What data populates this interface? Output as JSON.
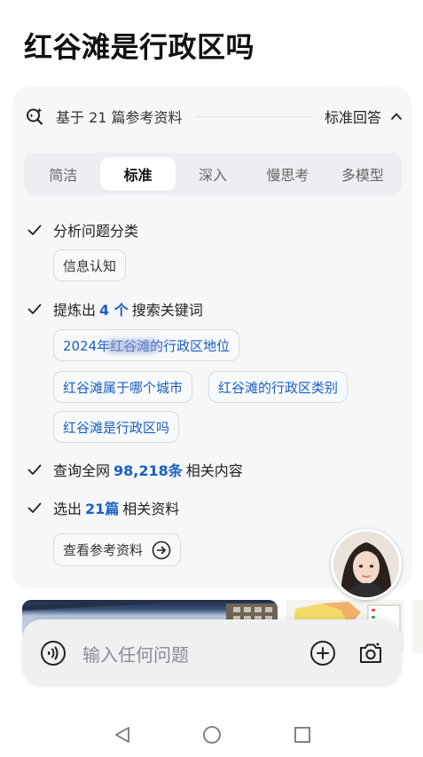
{
  "page": {
    "title": "红谷滩是行政区吗"
  },
  "references": {
    "summary": "基于 21 篇参考资料",
    "mode": "标准回答"
  },
  "tabs": [
    {
      "label": "简洁",
      "active": false
    },
    {
      "label": "标准",
      "active": true
    },
    {
      "label": "深入",
      "active": false
    },
    {
      "label": "慢思考",
      "active": false
    },
    {
      "label": "多模型",
      "active": false
    }
  ],
  "steps": {
    "classify": {
      "label": "分析问题分类",
      "chip": "信息认知"
    },
    "keywords": {
      "prefix": "提炼出",
      "count": "4 个",
      "suffix": "搜索关键词",
      "chips": [
        "2024年红谷滩的行政区地位",
        "红谷滩属于哪个城市",
        "红谷滩的行政区类别",
        "红谷滩是行政区吗"
      ]
    },
    "search": {
      "prefix": "查询全网",
      "count": "98,218条",
      "suffix": "相关内容"
    },
    "select": {
      "prefix": "选出",
      "count": "21篇",
      "suffix": "相关资料",
      "button": "查看参考资料"
    }
  },
  "input": {
    "placeholder": "输入任何问题"
  },
  "colors": {
    "accent": "#1a5fc4",
    "card_bg": "#f6f7f9",
    "tab_bg": "#eceef2"
  },
  "icons": [
    "search-sparkle-icon",
    "chevron-up-icon",
    "check-icon",
    "arrow-right-circle-icon",
    "voice-icon",
    "plus-circle-icon",
    "camera-icon",
    "back-icon",
    "home-icon",
    "recents-icon"
  ]
}
